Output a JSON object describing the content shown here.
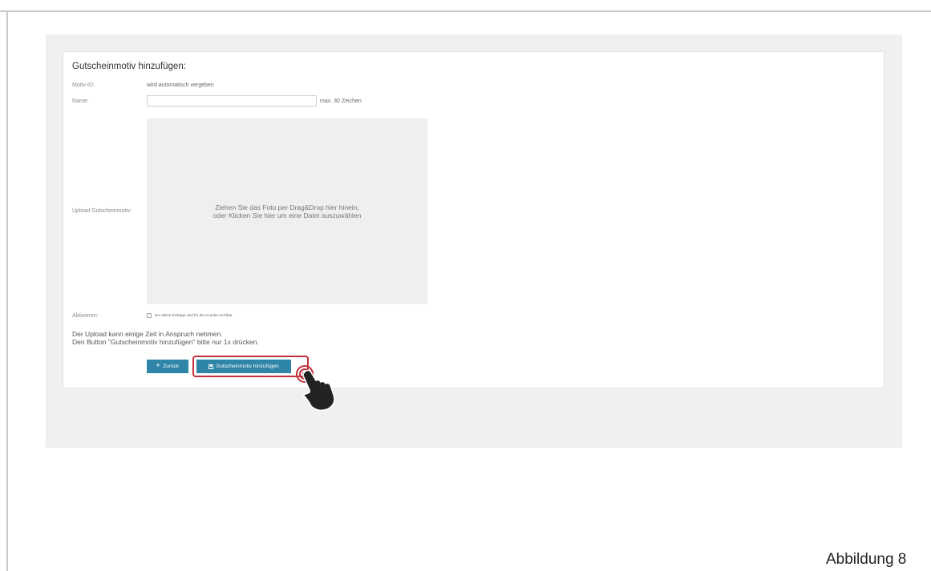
{
  "form": {
    "title": "Gutscheinmotiv hinzufügen:",
    "motiv_id": {
      "label": "Motiv-ID:",
      "value": "wird automatisch vergeben"
    },
    "name": {
      "label": "Name:",
      "value": "",
      "placeholder": "",
      "hint": "max. 30 Zeichen"
    },
    "upload": {
      "label": "Upload Gutscheinmotiv:",
      "dropzone_line1": "Ziehen Sie das Foto per Drag&Drop hier hinein,",
      "dropzone_line2": "oder Klicken Sie hier um eine Datei auszuwählen"
    },
    "activate": {
      "label": "Aktivieren:",
      "checkbox_label": "Nur aktive Einträge sind für den Kunden sichtbar",
      "checked": false
    },
    "note_line1": "Der Upload kann einige Zeit in Anspruch nehmen.",
    "note_line2": "Den Button \"Gutscheinmotiv hinzufügen\" bitte nur 1x drücken.",
    "buttons": {
      "back": {
        "label": "Zurück",
        "icon": "arrow-left-icon"
      },
      "add": {
        "label": "Gutscheinmotiv hinzufügen",
        "icon": "save-icon"
      }
    }
  },
  "pointer": {
    "icon": "hand-pointer-icon"
  },
  "caption": "Abbildung 8",
  "colors": {
    "accent": "#2f85a7",
    "highlight": "#c0303c",
    "page_bg": "#f0f0ef"
  }
}
